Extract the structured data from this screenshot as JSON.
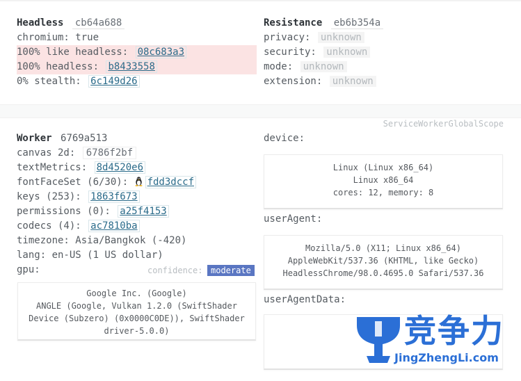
{
  "headless": {
    "title": "Headless",
    "hash": "cb64a688",
    "rows": [
      {
        "label": "chromium: ",
        "value": "true"
      },
      {
        "label": "100% like headless: ",
        "value": "08c683a3"
      },
      {
        "label": "100% headless: ",
        "value": "b8433558"
      },
      {
        "label": "0% stealth: ",
        "value": "6c149d26"
      }
    ]
  },
  "resistance": {
    "title": "Resistance",
    "hash": "eb6b354a",
    "rows": [
      {
        "label": "privacy: ",
        "value": "unknown"
      },
      {
        "label": "security: ",
        "value": "unknown"
      },
      {
        "label": "mode: ",
        "value": "unknown"
      },
      {
        "label": "extension: ",
        "value": "unknown"
      }
    ]
  },
  "scope_label": "ServiceWorkerGlobalScope",
  "worker": {
    "title": "Worker",
    "hash": "6769a513",
    "canvas_label": "canvas 2d: ",
    "canvas_value": "6786f2bf",
    "textmetrics_label": "textMetrics: ",
    "textmetrics_value": "8d4520e6",
    "fontfaceset_label": "fontFaceSet (6/30): ",
    "fontfaceset_value": "fdd3dccf",
    "keys_label": "keys (253): ",
    "keys_value": "1863f673",
    "permissions_label": "permissions (0): ",
    "permissions_value": "a25f4153",
    "codecs_label": "codecs (4): ",
    "codecs_value": "ac7810ba",
    "timezone": "timezone: Asia/Bangkok (-420)",
    "lang": "lang: en-US (1 US dollar)",
    "gpu_label": "gpu:",
    "confidence_label": "confidence:",
    "confidence_value": "moderate",
    "gpu_lines": [
      "Google Inc. (Google)",
      "ANGLE (Google, Vulkan 1.2.0 (SwiftShader",
      "Device (Subzero) (0x0000C0DE)), SwiftShader",
      "driver-5.0.0)"
    ]
  },
  "device": {
    "label": "device:",
    "lines": [
      "Linux (Linux x86_64)",
      "Linux x86_64",
      "cores: 12, memory: 8"
    ]
  },
  "useragent": {
    "label": "userAgent:",
    "lines": [
      "Mozilla/5.0 (X11; Linux x86_64)",
      "AppleWebKit/537.36 (KHTML, like Gecko)",
      "HeadlessChrome/98.0.4695.0 Safari/537.36"
    ]
  },
  "useragentdata": {
    "label": "userAgentData:"
  },
  "watermark": {
    "cn": "竞争力",
    "en": "JingZhengLi.com"
  },
  "colors": {
    "link": "#2a6b8a",
    "highlight": "#fbe3e3",
    "badge": "#5a76c2",
    "watermark": "#2b6fd6"
  }
}
